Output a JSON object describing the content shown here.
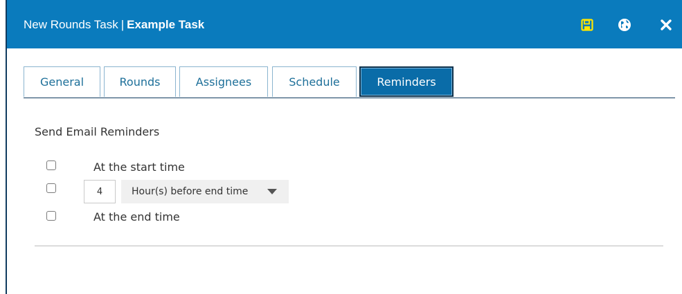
{
  "dialog": {
    "title_prefix": "New Rounds Task",
    "title_separator": "|",
    "title_name": "Example Task",
    "icons": {
      "save": "save-icon",
      "globe": "globe-icon",
      "close": "close-icon"
    },
    "colors": {
      "header": "#0a7bbd",
      "save_icon": "#ffe600",
      "active_tab": "#0a6ca8"
    }
  },
  "tabs": [
    {
      "label": "General",
      "active": false
    },
    {
      "label": "Rounds",
      "active": false
    },
    {
      "label": "Assignees",
      "active": false
    },
    {
      "label": "Schedule",
      "active": false
    },
    {
      "label": "Reminders",
      "active": true
    }
  ],
  "reminders": {
    "section_title": "Send Email Reminders",
    "options": [
      {
        "label": "At the start time",
        "checked": false
      },
      {
        "label": "",
        "checked": false,
        "number": "4",
        "unit": "Hour(s) before end time"
      },
      {
        "label": "At the end time",
        "checked": false
      }
    ]
  }
}
